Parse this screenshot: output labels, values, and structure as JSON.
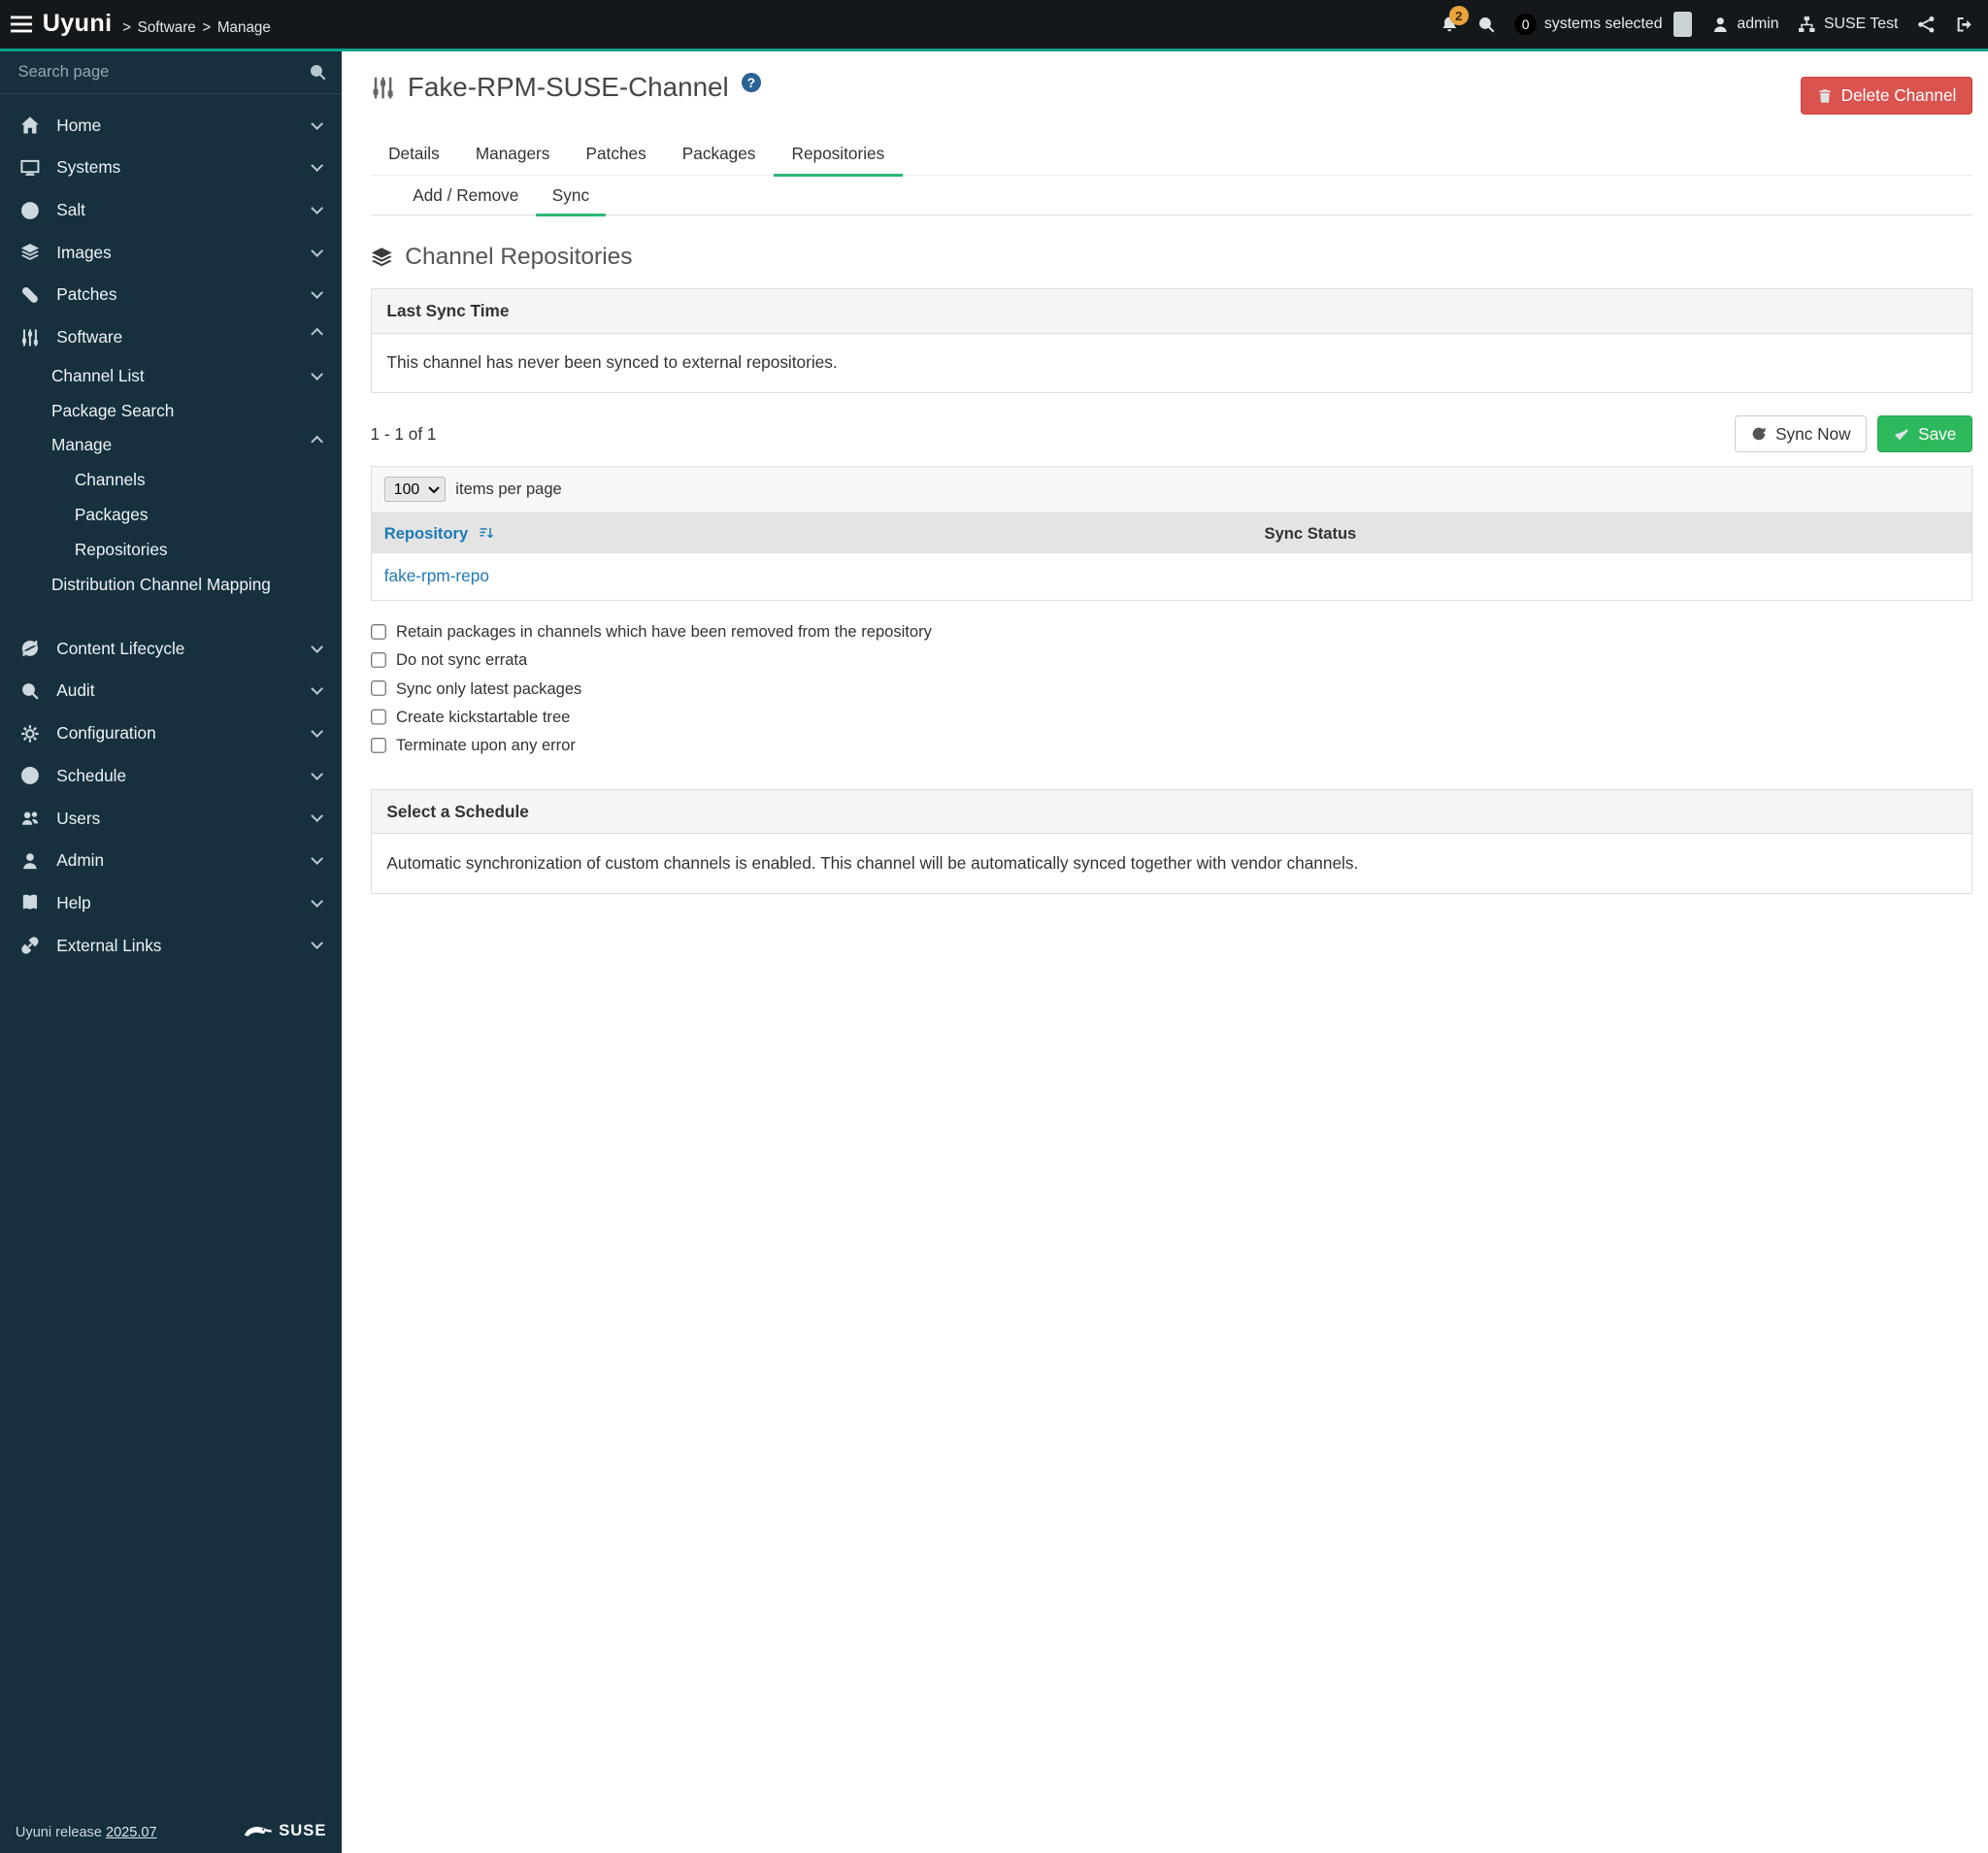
{
  "colors": {
    "topbar_bg": "#14181b",
    "topbar_accent": "#0ea189",
    "sidebar_bg": "#16303e",
    "tab_accent_green": "#2db873",
    "link_blue": "#1e79b5",
    "danger_red": "#d9534f",
    "save_green": "#2eb85c",
    "notification_orange": "#e9a33b"
  },
  "topbar": {
    "brand": "Uyuni",
    "crumb_separator": ">",
    "breadcrumbs": [
      "Software",
      "Manage"
    ],
    "notification_count": "2",
    "systems_selected_count": "0",
    "systems_selected_label": "systems selected",
    "user": "admin",
    "org": "SUSE Test"
  },
  "icons": [
    "menu-icon",
    "bell-icon",
    "search-icon",
    "user-icon",
    "org-icon",
    "share-nodes-icon",
    "sign-out-icon",
    "channel-icon",
    "help-icon",
    "trash-icon",
    "layers-icon",
    "refresh-icon",
    "check-icon",
    "sort-icon",
    "gecko-icon",
    "chevron-down-icon",
    "chevron-up-icon"
  ],
  "sidebar": {
    "search_placeholder": "Search page",
    "items": [
      {
        "label": "Home",
        "icon": "home-icon",
        "expandable": true
      },
      {
        "label": "Systems",
        "icon": "systems-icon",
        "expandable": true
      },
      {
        "label": "Salt",
        "icon": "salt-icon",
        "expandable": true
      },
      {
        "label": "Images",
        "icon": "images-icon",
        "expandable": true
      },
      {
        "label": "Patches",
        "icon": "patches-icon",
        "expandable": true
      },
      {
        "label": "Software",
        "icon": "software-icon",
        "expandable": true,
        "expanded": true,
        "children": [
          {
            "label": "Channel List",
            "expandable": true
          },
          {
            "label": "Package Search"
          },
          {
            "label": "Manage",
            "expandable": true,
            "expanded": true,
            "children": [
              {
                "label": "Channels"
              },
              {
                "label": "Packages"
              },
              {
                "label": "Repositories",
                "active": true
              }
            ]
          },
          {
            "label": "Distribution Channel Mapping"
          }
        ]
      },
      {
        "label": "Content Lifecycle",
        "icon": "content-lifecycle-icon",
        "expandable": true
      },
      {
        "label": "Audit",
        "icon": "audit-icon",
        "expandable": true
      },
      {
        "label": "Configuration",
        "icon": "configuration-icon",
        "expandable": true
      },
      {
        "label": "Schedule",
        "icon": "schedule-icon",
        "expandable": true
      },
      {
        "label": "Users",
        "icon": "users-icon",
        "expandable": true
      },
      {
        "label": "Admin",
        "icon": "admin-icon",
        "expandable": true
      },
      {
        "label": "Help",
        "icon": "help-book-icon",
        "expandable": true
      },
      {
        "label": "External Links",
        "icon": "external-links-icon",
        "expandable": true
      }
    ],
    "footer": {
      "release_prefix": "Uyuni release",
      "release_version": "2025.07",
      "logo_text": "SUSE"
    }
  },
  "page": {
    "title": "Fake-RPM-SUSE-Channel",
    "help_label": "?",
    "delete_button": "Delete Channel",
    "tabs": [
      "Details",
      "Managers",
      "Patches",
      "Packages",
      "Repositories"
    ],
    "active_tab": "Repositories",
    "subtabs": [
      "Add / Remove",
      "Sync"
    ],
    "active_subtab": "Sync",
    "section_title": "Channel Repositories"
  },
  "last_sync_panel": {
    "title": "Last Sync Time",
    "body": "This channel has never been synced to external repositories."
  },
  "pagination": {
    "range": "1 - 1 of 1",
    "sync_now": "Sync Now",
    "save": "Save"
  },
  "table": {
    "items_per_page_value": "100",
    "items_per_page_label": "items per page",
    "columns": [
      "Repository",
      "Sync Status"
    ],
    "rows": [
      {
        "repository": "fake-rpm-repo",
        "sync_status": ""
      }
    ]
  },
  "options": [
    "Retain packages in channels which have been removed from the repository",
    "Do not sync errata",
    "Sync only latest packages",
    "Create kickstartable tree",
    "Terminate upon any error"
  ],
  "schedule_panel": {
    "title": "Select a Schedule",
    "body": "Automatic synchronization of custom channels is enabled. This channel will be automatically synced together with vendor channels."
  }
}
